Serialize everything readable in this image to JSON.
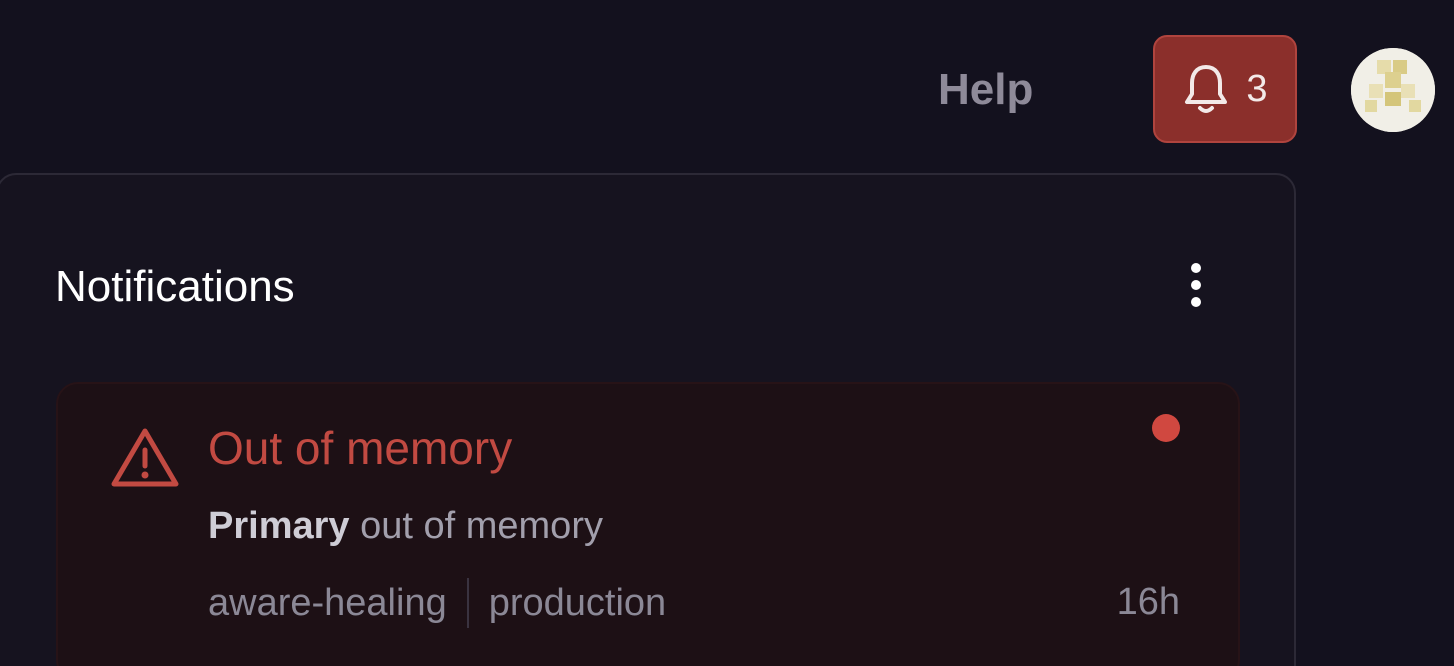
{
  "header": {
    "help_label": "Help",
    "notification_count": "3",
    "icons": {
      "bell": "bell-icon",
      "avatar": "avatar"
    }
  },
  "panel": {
    "title": "Notifications",
    "menu_icon": "more-vertical-icon",
    "notifications": [
      {
        "icon": "warning-triangle-icon",
        "title": "Out of memory",
        "subject": "Primary",
        "message": "out of memory",
        "project": "aware-healing",
        "environment": "production",
        "time": "16h",
        "unread": true
      }
    ]
  },
  "colors": {
    "background": "#13111e",
    "badge": "#8b2f2b",
    "alert": "#c24a42",
    "unread_dot": "#d04840"
  }
}
